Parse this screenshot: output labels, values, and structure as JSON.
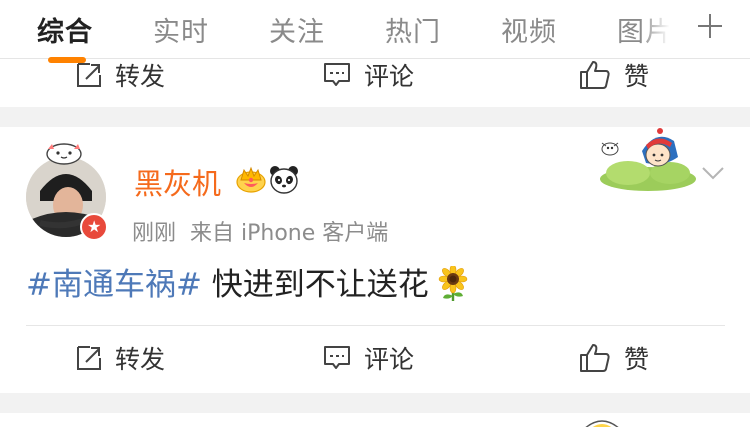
{
  "tabs": [
    {
      "label": "综合",
      "active": true
    },
    {
      "label": "实时",
      "active": false
    },
    {
      "label": "关注",
      "active": false
    },
    {
      "label": "热门",
      "active": false
    },
    {
      "label": "视频",
      "active": false
    },
    {
      "label": "图片",
      "active": false
    }
  ],
  "actions": {
    "forward_label": "转发",
    "comment_label": "评论",
    "like_label": "赞"
  },
  "post": {
    "username": "黑灰机",
    "time": "刚刚",
    "source": "来自 iPhone 客户端",
    "hashtag": "#南通车祸#",
    "text": " 快进到不让送花",
    "verified_symbol": "★"
  },
  "colors": {
    "accent": "#ff8200",
    "username": "#f56a1c",
    "hashtag": "#4e79b8",
    "verified": "#e8493b"
  },
  "icons": [
    "plus-icon",
    "crown-icon",
    "panda-icon",
    "cartoon-sticker",
    "chevron-down-icon",
    "sunflower-icon",
    "forward-icon",
    "comment-icon",
    "like-icon"
  ]
}
